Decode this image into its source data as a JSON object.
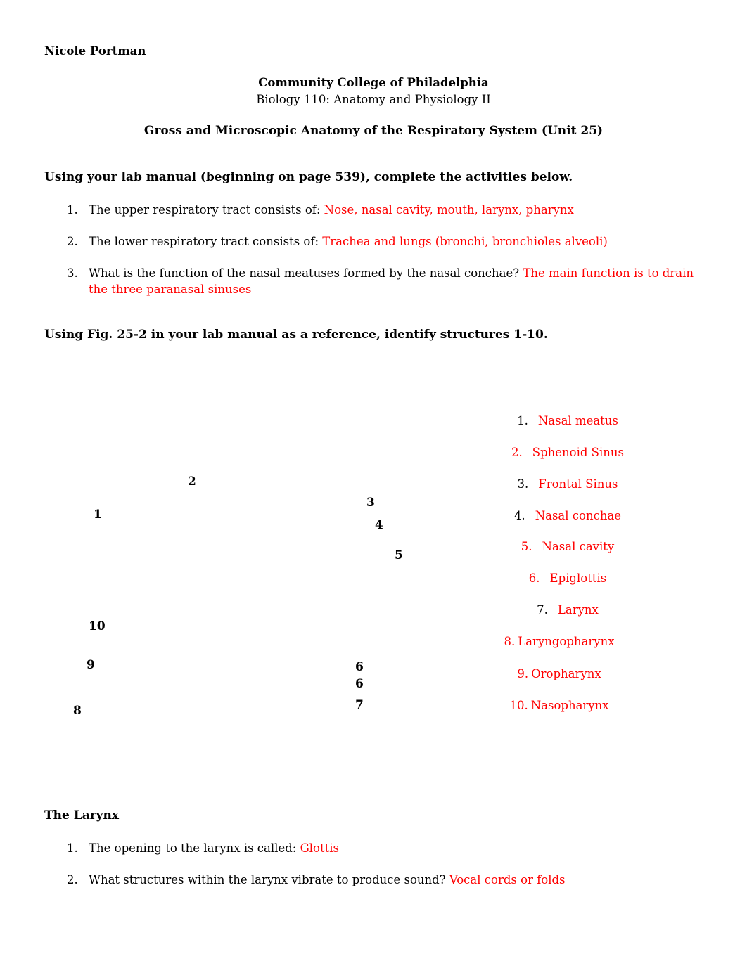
{
  "header": {
    "student_name": "Nicole Portman",
    "institution": "Community College of Philadelphia",
    "course": "Biology 110: Anatomy and Physiology II",
    "title": "Gross and Microscopic Anatomy of the Respiratory System (Unit 25)"
  },
  "section1": {
    "heading": "Using your lab manual (beginning on page 539), complete the activities below.",
    "questions": [
      {
        "num": "1.",
        "prompt": "The upper respiratory tract consists of:",
        "answer": "Nose, nasal cavity, mouth, larynx, pharynx"
      },
      {
        "num": "2.",
        "prompt": "The lower respiratory tract consists of:",
        "answer": "Trachea and lungs (bronchi, bronchioles alveoli)"
      },
      {
        "num": "3.",
        "prompt": "What is the function of the nasal meatuses formed by the nasal conchae?",
        "answer": "The main function is to drain the three paranasal sinuses"
      }
    ]
  },
  "section2": {
    "heading": "Using Fig. 25-2 in your lab manual as a reference, identify structures 1-10.",
    "figure_labels": [
      "2",
      "1",
      "3",
      "4",
      "5",
      "10",
      "9",
      "6",
      "6",
      "7",
      "8"
    ],
    "answers": [
      {
        "num": "1.",
        "num_color": "#000000",
        "text": "Nasal meatus"
      },
      {
        "num": "2.",
        "num_color": "#ff0000",
        "text": "Sphenoid Sinus"
      },
      {
        "num": "3.",
        "num_color": "#000000",
        "text": "Frontal Sinus"
      },
      {
        "num": "4.",
        "num_color": "#000000",
        "text": "Nasal conchae"
      },
      {
        "num": "5.",
        "num_color": "#ff0000",
        "text": "Nasal cavity"
      },
      {
        "num": "6.",
        "num_color": "#ff0000",
        "text": "Epiglottis"
      },
      {
        "num": "7.",
        "num_color": "#000000",
        "text": "Larynx"
      },
      {
        "num": "8.",
        "num_color": "#ff0000",
        "text": "Laryngopharynx"
      },
      {
        "num": "9.",
        "num_color": "#ff0000",
        "text": "Oropharynx"
      },
      {
        "num": "10.",
        "num_color": "#ff0000",
        "text": "Nasopharynx"
      }
    ]
  },
  "section3": {
    "heading": "The Larynx",
    "questions": [
      {
        "num": "1.",
        "prompt": "The opening to the larynx is called:",
        "answer": "Glottis"
      },
      {
        "num": "2.",
        "prompt": "What structures within the larynx vibrate to produce sound?",
        "answer": "Vocal cords or folds"
      }
    ]
  },
  "colors": {
    "answer": "#ff0000",
    "text": "#000000"
  }
}
